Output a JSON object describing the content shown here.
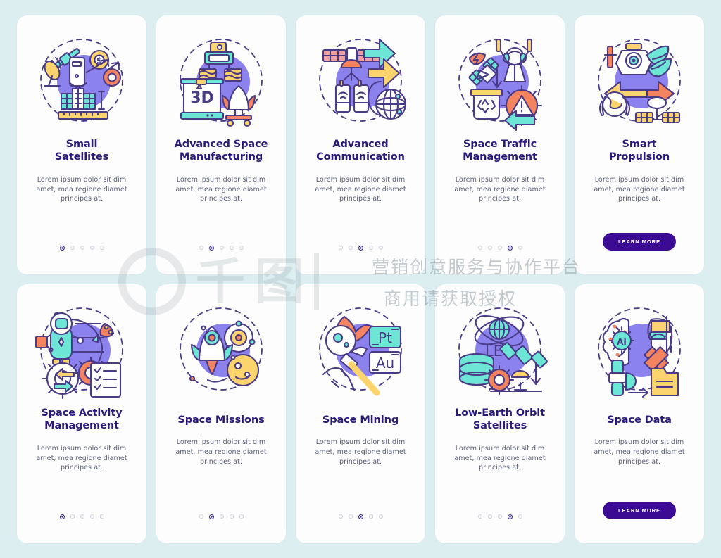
{
  "page": {
    "background_color": "#ddeef1",
    "card_background": "#fdfdfd",
    "title_color": "#2b1a7a",
    "body_color": "#5c5f7a",
    "accent_purple": "#3b0b93",
    "dot_active_color": "#3a2a8c",
    "dot_inactive_color": "#c9cbd8"
  },
  "watermark": {
    "brand_char_1": "千",
    "brand_char_2": "图",
    "line_1": "营销创意服务与协作平台",
    "line_2": "商用请获取授权"
  },
  "cards": [
    {
      "id": "small-satellites",
      "icon": "satellite-gear-icon",
      "title": "Small\nSatellites",
      "title_lines": [
        "Small",
        "Satellites"
      ],
      "description": "Lorem ipsum dolor sit dim amet, mea regione diamet principes at.",
      "dots": 5,
      "active_dot": 1,
      "has_button": false,
      "button_label": ""
    },
    {
      "id": "advanced-space-manufacturing",
      "icon": "3d-printer-rocket-icon",
      "title": "Advanced Space\nManufacturing",
      "title_lines": [
        "Advanced Space",
        "Manufacturing"
      ],
      "description": "Lorem ipsum dolor sit dim amet, mea regione diamet principes at.",
      "dots": 5,
      "active_dot": 2,
      "has_button": false,
      "button_label": ""
    },
    {
      "id": "advanced-communication",
      "icon": "satellite-phone-globe-icon",
      "title": "Advanced\nCommunication",
      "title_lines": [
        "Advanced",
        "Communication"
      ],
      "description": "Lorem ipsum dolor sit dim amet, mea regione diamet principes at.",
      "dots": 5,
      "active_dot": 3,
      "has_button": false,
      "button_label": ""
    },
    {
      "id": "space-traffic-management",
      "icon": "traffic-controller-warning-icon",
      "title": "Space Traffic\nManagement",
      "title_lines": [
        "Space Traffic",
        "Management"
      ],
      "description": "Lorem ipsum dolor sit dim amet, mea regione diamet principes at.",
      "dots": 5,
      "active_dot": 4,
      "has_button": false,
      "button_label": ""
    },
    {
      "id": "smart-propulsion",
      "icon": "engine-leaf-earth-icon",
      "title": "Smart\nPropulsion",
      "title_lines": [
        "Smart",
        "Propulsion"
      ],
      "description": "Lorem ipsum dolor sit dim amet, mea regione diamet principes at.",
      "dots": 0,
      "active_dot": 0,
      "has_button": true,
      "button_label": "LEARN MORE"
    },
    {
      "id": "space-activity-management",
      "icon": "astronaut-checklist-gears-icon",
      "title": "Space Activity\nManagement",
      "title_lines": [
        "Space Activity",
        "Management"
      ],
      "description": "Lorem ipsum dolor sit dim amet, mea regione diamet principes at.",
      "dots": 5,
      "active_dot": 1,
      "has_button": false,
      "button_label": ""
    },
    {
      "id": "space-missions",
      "icon": "rocket-planets-icon",
      "title": "Space Missions",
      "title_lines": [
        "Space Missions"
      ],
      "description": "Lorem ipsum dolor sit dim amet, mea regione diamet principes at.",
      "dots": 5,
      "active_dot": 2,
      "has_button": false,
      "button_label": ""
    },
    {
      "id": "space-mining",
      "icon": "asteroid-pickaxe-elements-icon",
      "title": "Space Mining",
      "title_lines": [
        "Space Mining"
      ],
      "description": "Lorem ipsum dolor sit dim amet, mea regione diamet principes at.",
      "dots": 5,
      "active_dot": 3,
      "has_button": false,
      "button_label": ""
    },
    {
      "id": "low-earth-orbit-satellites",
      "icon": "leo-database-satellite-icon",
      "title": "Low-Earth Orbit\nSatellites",
      "title_lines": [
        "Low-Earth Orbit",
        "Satellites"
      ],
      "description": "Lorem ipsum dolor sit dim amet, mea regione diamet principes at.",
      "dots": 5,
      "active_dot": 4,
      "has_button": false,
      "button_label": ""
    },
    {
      "id": "space-data",
      "icon": "ai-brain-data-icon",
      "title": "Space Data",
      "title_lines": [
        "Space Data"
      ],
      "description": "Lorem ipsum dolor sit dim amet, mea regione diamet principes at.",
      "dots": 0,
      "active_dot": 0,
      "has_button": true,
      "button_label": "LEARN MORE"
    }
  ],
  "illustration_palette": {
    "blob_purple": "#8b82ee",
    "teal": "#6ee6d6",
    "orange": "#f4845f",
    "yellow": "#fbd46d",
    "outline": "#4a3b86",
    "pink": "#f0a2a2",
    "white": "#ffffff"
  }
}
